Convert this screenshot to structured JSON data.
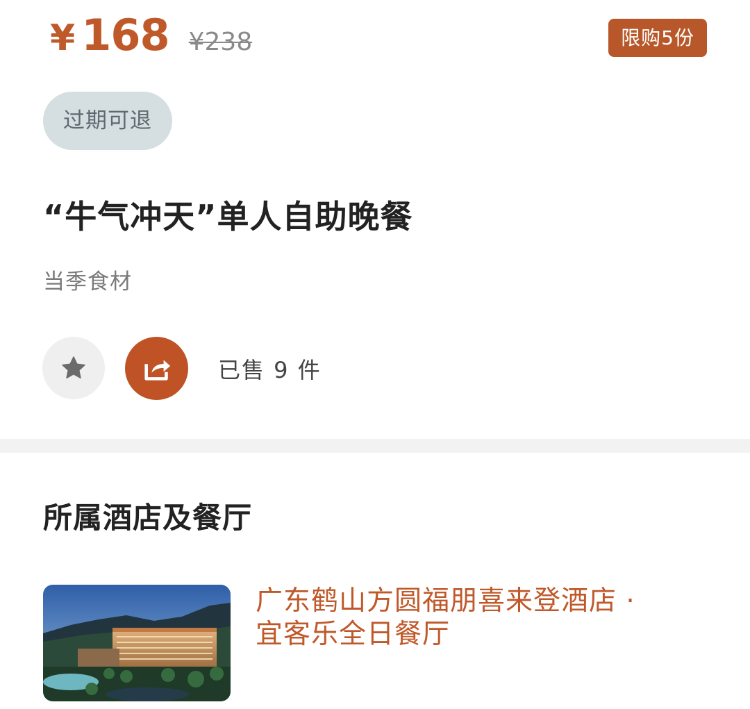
{
  "product": {
    "currency": "¥",
    "price": "168",
    "original_price": "¥238",
    "limit_badge": "限购5份",
    "refund_tag": "过期可退",
    "title": "“牛气冲天”单人自助晚餐",
    "subtitle": "当季食材",
    "sold": "已售 9 件"
  },
  "actions": {
    "favorite_icon": "star-icon",
    "share_icon": "share-icon"
  },
  "section": {
    "title": "所属酒店及餐厅"
  },
  "hotel": {
    "name_line1": "广东鹤山方圆福朋喜来登酒店 ·",
    "name_line2": "宜客乐全日餐厅"
  },
  "colors": {
    "accent": "#c0592a",
    "badge": "#b8582a",
    "share_button": "#bf5326",
    "refund_tag_bg": "#d5dfe2"
  }
}
